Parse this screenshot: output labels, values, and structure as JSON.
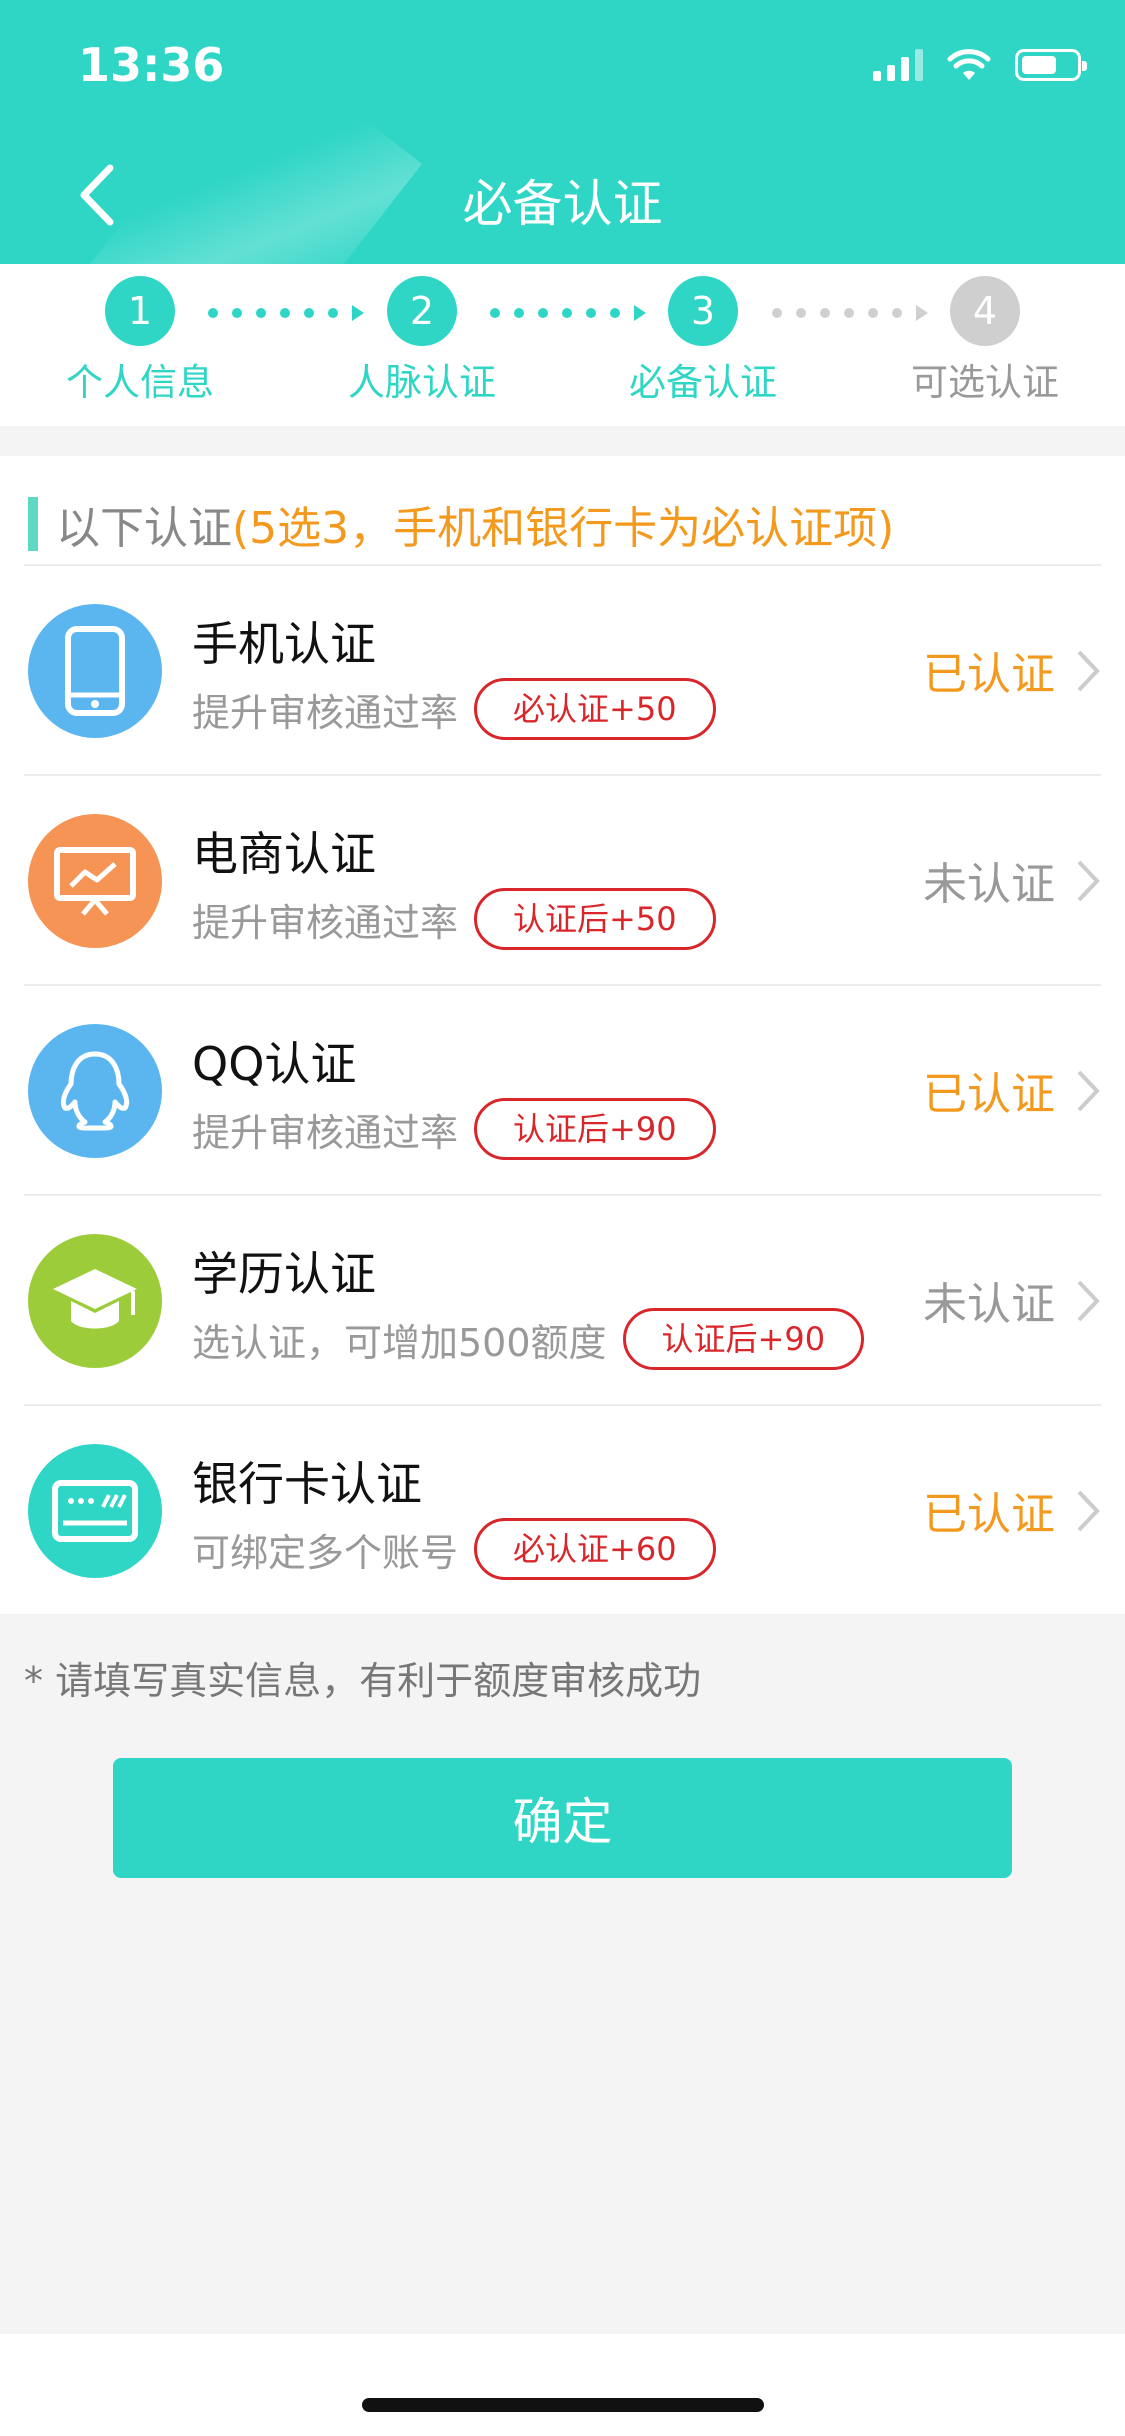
{
  "status_bar": {
    "time": "13:36"
  },
  "nav": {
    "title": "必备认证"
  },
  "steps": [
    {
      "number": "1",
      "label": "个人信息",
      "active": true
    },
    {
      "number": "2",
      "label": "人脉认证",
      "active": true
    },
    {
      "number": "3",
      "label": "必备认证",
      "active": true
    },
    {
      "number": "4",
      "label": "可选认证",
      "active": false
    }
  ],
  "hint": {
    "prefix": "以下认证",
    "highlight": "(5选3，手机和银行卡为必认证项)"
  },
  "items": [
    {
      "title": "手机认证",
      "desc": "提升审核通过率",
      "tag": "必认证+50",
      "status": "已认证",
      "icon": "phone-icon",
      "icon_color": "#5bb6f0",
      "done": true
    },
    {
      "title": "电商认证",
      "desc": "提升审核通过率",
      "tag": "认证后+50",
      "status": "未认证",
      "icon": "ecommerce-screen-icon",
      "icon_color": "#f59455",
      "done": false
    },
    {
      "title": "QQ认证",
      "desc": "提升审核通过率",
      "tag": "认证后+90",
      "status": "已认证",
      "icon": "qq-penguin-icon",
      "icon_color": "#5bb6f0",
      "done": true
    },
    {
      "title": "学历认证",
      "desc": "选认证，可增加500额度",
      "tag": "认证后+90",
      "status": "未认证",
      "icon": "graduation-cap-icon",
      "icon_color": "#9ccc3a",
      "done": false
    },
    {
      "title": "银行卡认证",
      "desc": "可绑定多个账号",
      "tag": "必认证+60",
      "status": "已认证",
      "icon": "bank-card-icon",
      "icon_color": "#2fd6c6",
      "done": true
    }
  ],
  "note": "* 请填写真实信息，有利于额度审核成功",
  "confirm_label": "确定",
  "colors": {
    "primary": "#2fd6c6",
    "verified": "#f39a1e",
    "tag_red": "#d9262b"
  }
}
